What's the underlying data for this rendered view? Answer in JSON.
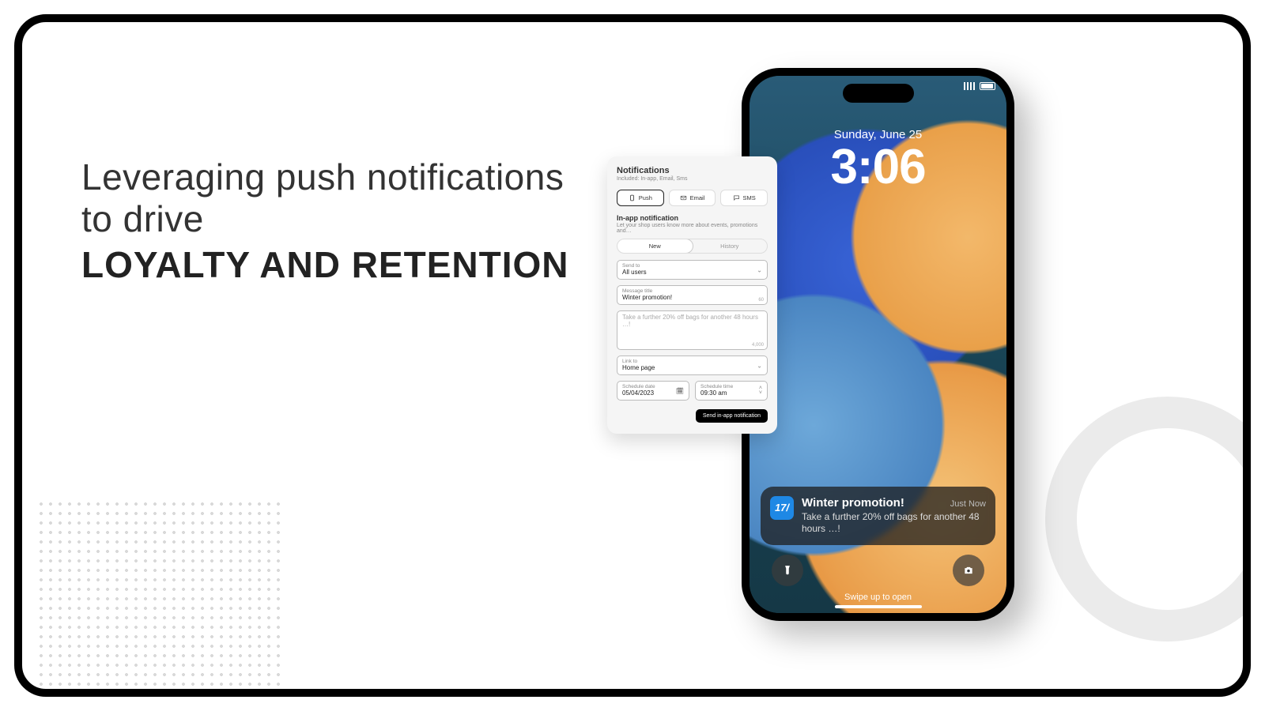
{
  "headline": {
    "light": "Leveraging push notifications to drive",
    "bold": "LOYALTY AND RETENTION"
  },
  "phone": {
    "date": "Sunday, June 25",
    "time": "3:06",
    "swipe": "Swipe up to open",
    "notification": {
      "app_badge": "17/",
      "title": "Winter promotion!",
      "ago": "Just Now",
      "message": "Take a further 20% off bags for another 48 hours …!"
    }
  },
  "card": {
    "title": "Notifications",
    "subtitle": "Included: In-app, Email, Sms",
    "channels": {
      "push": "Push",
      "email": "Email",
      "sms": "SMS"
    },
    "section_title": "In-app notification",
    "section_sub": "Let your shop users know more about events, promotions and…",
    "seg": {
      "new": "New",
      "history": "History"
    },
    "send_to": {
      "label": "Send to",
      "value": "All users"
    },
    "msg_title": {
      "label": "Message title",
      "value": "Winter promotion!",
      "counter": "60"
    },
    "body": {
      "value": "Take a further 20% off bags for another 48 hours …!",
      "counter": "4,000"
    },
    "link": {
      "label": "Link to",
      "value": "Home page"
    },
    "date": {
      "label": "Schedule date",
      "value": "05/04/2023"
    },
    "time": {
      "label": "Schedule time",
      "value": "09:30 am"
    },
    "button": "Send in-app notification"
  }
}
